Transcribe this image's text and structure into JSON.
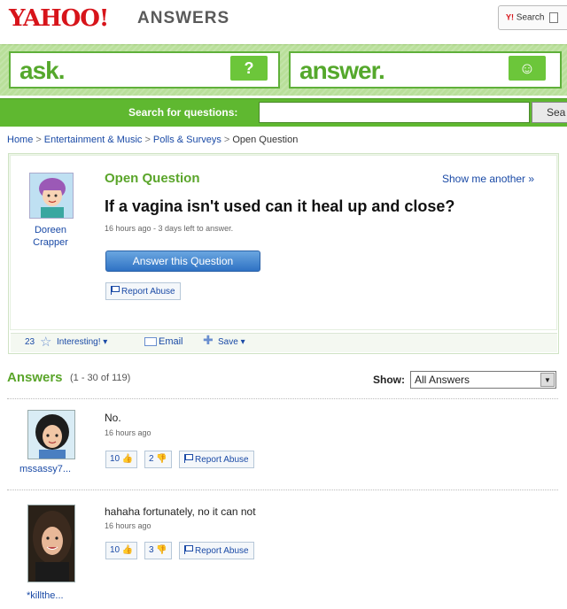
{
  "header": {
    "logo": "YAHOO!",
    "logo_sub": "ANSWERS",
    "top_search_label": "Search",
    "top_search_brand": "Y!"
  },
  "nav": {
    "ask_label": "ask.",
    "ask_icon": "?",
    "answer_label": "answer.",
    "answer_icon": "☺",
    "search_label": "Search for questions:",
    "search_placeholder": "",
    "search_button": "Sea"
  },
  "breadcrumb": [
    "Home",
    "Entertainment & Music",
    "Polls & Surveys",
    "Open Question"
  ],
  "question": {
    "status": "Open Question",
    "show_another": "Show me another »",
    "title": "If a vagina isn't used can it heal up and close?",
    "meta": "16 hours ago - 3 days left to answer.",
    "asker": "Doreen Crapper",
    "answer_button": "Answer this Question",
    "report_label": "Report Abuse"
  },
  "toolbar": {
    "interesting_count": "23",
    "interesting_label": "Interesting! ▾",
    "email_label": "Email",
    "save_label": "Save ▾"
  },
  "answers_header": {
    "title": "Answers",
    "range": "(1 - 30 of 119)",
    "show_label": "Show:",
    "show_selected": "All Answers"
  },
  "answers": [
    {
      "user": "mssassy7...",
      "text": "No.",
      "meta": "16 hours ago",
      "thumbs_up": "10",
      "thumbs_down": "2",
      "report": "Report Abuse"
    },
    {
      "user": "*killthe...",
      "text": "hahaha fortunately, no it can not",
      "meta": "16 hours ago",
      "thumbs_up": "10",
      "thumbs_down": "3",
      "report": "Report Abuse"
    }
  ],
  "colors": {
    "brand_red": "#d7141a",
    "green": "#5fb830",
    "link_blue": "#1a4aa6"
  }
}
